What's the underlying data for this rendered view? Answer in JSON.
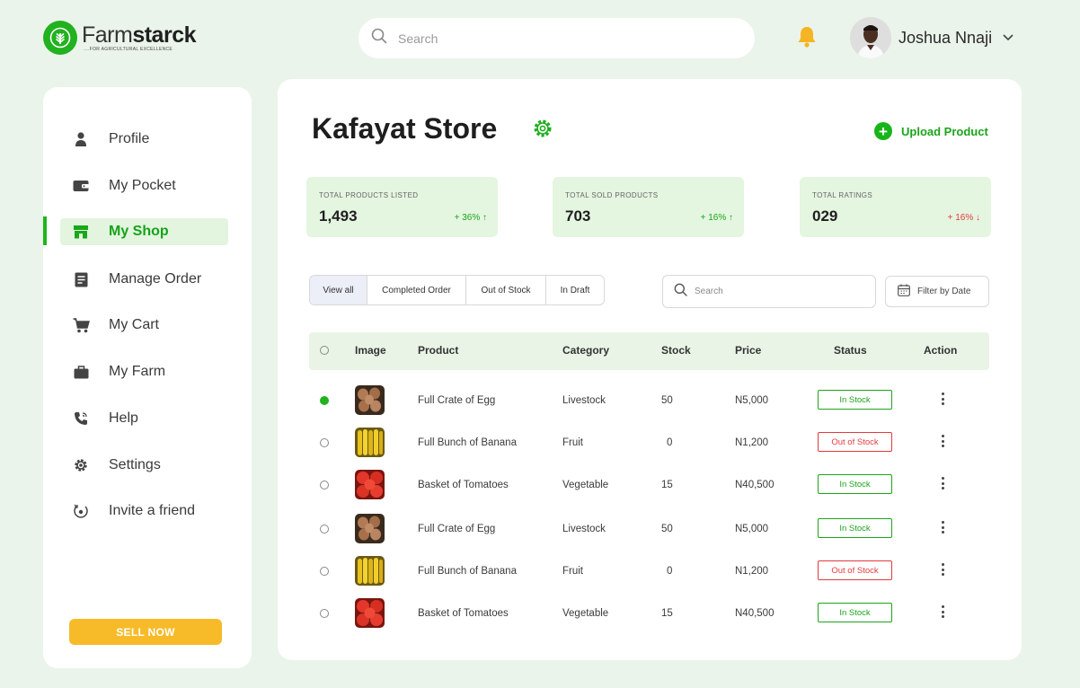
{
  "brand": {
    "name_light": "Farm",
    "name_bold": "starck",
    "tagline": "....FOR AGRICULTURAL EXCELLENCE"
  },
  "header": {
    "search_placeholder": "Search",
    "user_name": "Joshua Nnaji"
  },
  "sidebar": {
    "items": [
      {
        "label": "Profile",
        "icon": "user-icon"
      },
      {
        "label": "My Pocket",
        "icon": "wallet-icon"
      },
      {
        "label": "My Shop",
        "icon": "shop-icon",
        "active": true
      },
      {
        "label": "Manage Order",
        "icon": "order-icon"
      },
      {
        "label": "My Cart",
        "icon": "cart-icon"
      },
      {
        "label": "My Farm",
        "icon": "briefcase-icon"
      },
      {
        "label": "Help",
        "icon": "phone-icon"
      },
      {
        "label": "Settings",
        "icon": "gear-icon"
      },
      {
        "label": "Invite a friend",
        "icon": "invite-icon"
      }
    ],
    "sell_button": "SELL NOW"
  },
  "store": {
    "title": "Kafayat Store",
    "upload_label": "Upload Product"
  },
  "stats": [
    {
      "title": "TOTAL PRODUCTS LISTED",
      "value": "1,493",
      "change": "+ 36% ↑",
      "trend": "up"
    },
    {
      "title": "TOTAL SOLD PRODUCTS",
      "value": "703",
      "change": "+ 16% ↑",
      "trend": "up"
    },
    {
      "title": "TOTAL RATINGS",
      "value": "029",
      "change": "+ 16% ↓",
      "trend": "down"
    }
  ],
  "tabs": [
    "View all",
    "Completed Order",
    "Out of Stock",
    "In Draft"
  ],
  "table_search_placeholder": "Search",
  "filter_label": "Filter by Date",
  "table": {
    "headers": [
      "Image",
      "Product",
      "Category",
      "Stock",
      "Price",
      "Status",
      "Action"
    ],
    "rows": [
      {
        "product": "Full Crate of Egg",
        "category": "Livestock",
        "stock": "50",
        "price": "N5,000",
        "status": "In Stock",
        "image": "egg",
        "checked": true
      },
      {
        "product": "Full Bunch of Banana",
        "category": "Fruit",
        "stock": "0",
        "price": "N1,200",
        "status": "Out of Stock",
        "image": "banana",
        "checked": false
      },
      {
        "product": "Basket of Tomatoes",
        "category": "Vegetable",
        "stock": "15",
        "price": "N40,500",
        "status": "In Stock",
        "image": "tomato",
        "checked": false
      },
      {
        "product": "Full Crate of Egg",
        "category": "Livestock",
        "stock": "50",
        "price": "N5,000",
        "status": "In Stock",
        "image": "egg",
        "checked": false
      },
      {
        "product": "Full Bunch of Banana",
        "category": "Fruit",
        "stock": "0",
        "price": "N1,200",
        "status": "Out of Stock",
        "image": "banana",
        "checked": false
      },
      {
        "product": "Basket of Tomatoes",
        "category": "Vegetable",
        "stock": "15",
        "price": "N40,500",
        "status": "In Stock",
        "image": "tomato",
        "checked": false
      }
    ]
  },
  "colors": {
    "brand_green": "#1fb61c",
    "alert_red": "#e23b3b",
    "sell_yellow": "#f7bb2a",
    "page_bg": "#ebf4ea"
  }
}
